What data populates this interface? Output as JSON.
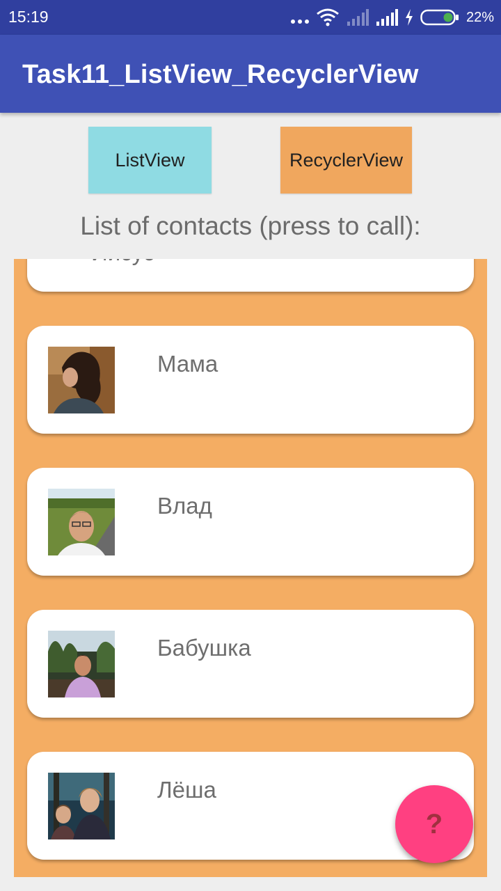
{
  "status_bar": {
    "time": "15:19",
    "battery": "22%",
    "icons": [
      "more-dots-icon",
      "wifi-icon",
      "signal-empty-icon",
      "signal-icon",
      "charging-icon",
      "battery-icon"
    ]
  },
  "app_bar": {
    "title": "Task11_ListView_RecyclerView"
  },
  "buttons": {
    "listview": "ListView",
    "recyclerview": "RecyclerView"
  },
  "heading": "List of contacts (press to call):",
  "contacts": [
    {
      "name": "Иисус"
    },
    {
      "name": "Мама"
    },
    {
      "name": "Влад"
    },
    {
      "name": "Бабушка"
    },
    {
      "name": "Лёша"
    }
  ],
  "fab": {
    "label": "?"
  },
  "colors": {
    "status_bar": "#303f9f",
    "app_bar": "#3f51b5",
    "listview_button": "#8fdbe3",
    "recyclerview_button": "#f0a75e",
    "list_background": "#f4ad63",
    "fab": "#ff4081"
  }
}
